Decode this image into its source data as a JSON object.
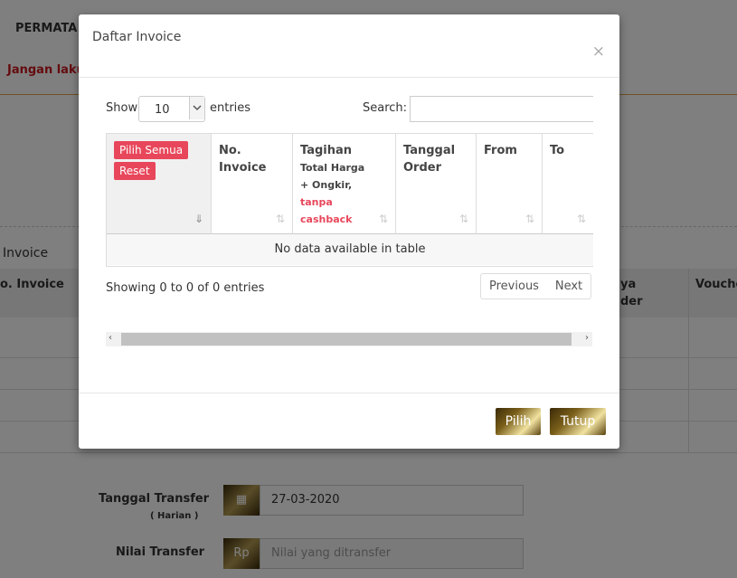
{
  "background": {
    "bank_name": "PERMATA",
    "warning_text": "Jangan laku",
    "section_label": "Invoice",
    "col_invoice": "o. Invoice",
    "col_ya": "ya",
    "col_der": "der",
    "col_voucher": "Vouche",
    "tanggal_transfer_label": "Tanggal Transfer",
    "tanggal_transfer_sub": "( Harian )",
    "tanggal_transfer_value": "27-03-2020",
    "nilai_transfer_label": "Nilai Transfer",
    "nilai_prefix": "Rp",
    "nilai_placeholder": "Nilai yang ditransfer"
  },
  "modal": {
    "title": "Daftar Invoice",
    "close": "×",
    "show_label": "Show",
    "entries_value": "10",
    "entries_label": "entries",
    "search_label": "Search:",
    "table": {
      "col_select_badges": [
        "Pilih Semua",
        "Reset"
      ],
      "col_no_invoice": "No. Invoice",
      "col_tagihan": "Tagihan",
      "col_tagihan_sub": "Total Harga + Ongkir,",
      "col_tagihan_sub_red": "tanpa cashback",
      "col_tanggal": "Tanggal Order",
      "col_from": "From",
      "col_to": "To",
      "empty_text": "No data available in table"
    },
    "info_text": "Showing 0 to 0 of 0 entries",
    "prev_label": "Previous",
    "next_label": "Next",
    "pilih_label": "Pilih",
    "tutup_label": "Tutup"
  },
  "colors": {
    "badge_red": "#e8475b",
    "warning_red": "#c9181e"
  }
}
